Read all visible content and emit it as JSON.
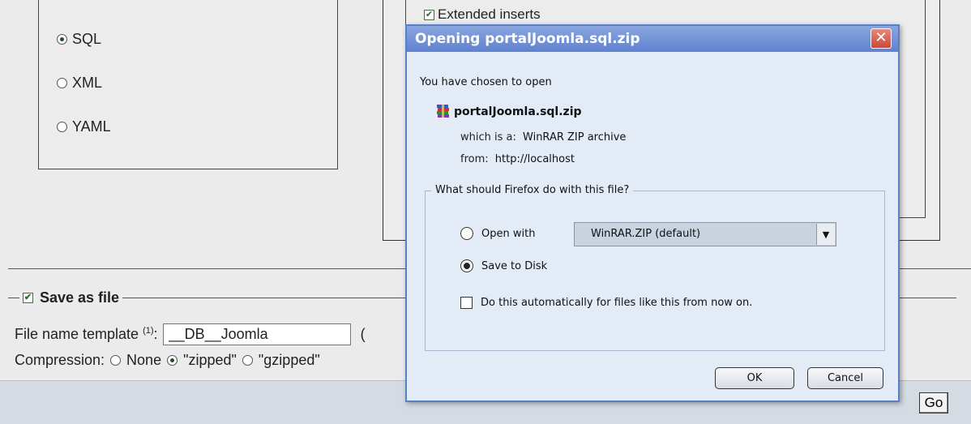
{
  "format_options": [
    {
      "label": "SQL",
      "checked": true
    },
    {
      "label": "XML",
      "checked": false
    },
    {
      "label": "YAML",
      "checked": false
    }
  ],
  "extended_inserts_label": "Extended inserts",
  "save_as_file": {
    "legend": "Save as file",
    "checked": true,
    "file_name_label": "File name template",
    "file_name_sup": "(1)",
    "file_name_value": "__DB__Joomla",
    "paren_open": "(",
    "compression_label": "Compression:",
    "compression_options": [
      {
        "label": "None",
        "checked": false
      },
      {
        "label": "\"zipped\"",
        "checked": true
      },
      {
        "label": "\"gzipped\"",
        "checked": false
      }
    ]
  },
  "go_label": "Go",
  "dialog": {
    "title": "Opening portalJoomla.sql.zip",
    "close_glyph": "✕",
    "intro": "You have chosen to open",
    "file_name": "portalJoomla.sql.zip",
    "which_is_label": "which is a:",
    "which_is_value": "WinRAR ZIP archive",
    "from_label": "from:",
    "from_value": "http://localhost",
    "question": "What should Firefox do with this file?",
    "open_with_label": "Open with",
    "open_with_app": "WinRAR.ZIP (default)",
    "save_to_disk_label": "Save to Disk",
    "auto_label": "Do this automatically for files like this from now on.",
    "ok_label": "OK",
    "cancel_label": "Cancel"
  },
  "colors": {
    "titlebar": "#5f82cf",
    "dialog_bg": "#e3ebf6",
    "close": "#c84a35"
  }
}
